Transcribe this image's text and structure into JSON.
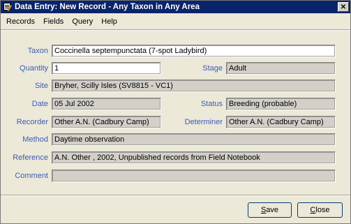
{
  "window": {
    "title": "Data Entry: New Record - Any Taxon in Any Area",
    "close_glyph": "✕"
  },
  "menu": [
    "Records",
    "Fields",
    "Query",
    "Help"
  ],
  "form": {
    "taxon": {
      "label": "Taxon",
      "value": "Coccinella septempunctata (7-spot Ladybird)"
    },
    "quantity": {
      "label": "Quantity",
      "value": "1"
    },
    "stage": {
      "label": "Stage",
      "value": "Adult"
    },
    "site": {
      "label": "Site",
      "value": "Bryher, Scilly Isles  (SV8815 - VC1)"
    },
    "date": {
      "label": "Date",
      "value": "05 Jul 2002"
    },
    "status": {
      "label": "Status",
      "value": "Breeding (probable)"
    },
    "recorder": {
      "label": "Recorder",
      "value": "Other A.N. (Cadbury Camp)"
    },
    "determiner": {
      "label": "Determiner",
      "value": "Other A.N. (Cadbury Camp)"
    },
    "method": {
      "label": "Method",
      "value": "Daytime observation"
    },
    "reference": {
      "label": "Reference",
      "value": "A.N. Other , 2002, Unpublished records from Field Notebook"
    },
    "comment": {
      "label": "Comment",
      "value": ""
    }
  },
  "buttons": {
    "save": {
      "first": "S",
      "rest": "ave"
    },
    "close": {
      "first": "C",
      "rest": "lose"
    }
  },
  "colors": {
    "title_bg": "#0a246a",
    "label_blue": "#3d5bb5",
    "face": "#ece9d8"
  }
}
